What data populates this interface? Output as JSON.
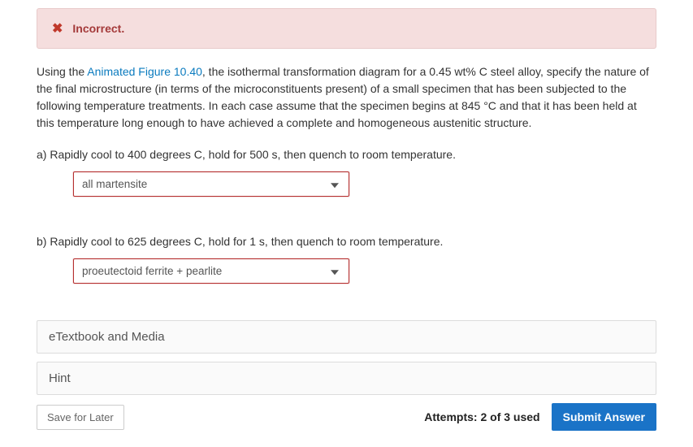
{
  "alert": {
    "icon_name": "x-icon",
    "text": "Incorrect."
  },
  "question": {
    "prefix": "Using the ",
    "link_text": "Animated Figure 10.40",
    "suffix": ", the isothermal transformation diagram for a 0.45 wt% C steel alloy, specify the nature of the final microstructure (in terms of the microconstituents present) of a small specimen that has been subjected to the following temperature treatments. In each case assume that the specimen begins at 845 °C and that it has been held at this temperature long enough to have achieved a complete and homogeneous austenitic structure."
  },
  "parts": {
    "a": {
      "label": "a) Rapidly cool to 400 degrees C, hold for 500 s, then quench to room temperature.",
      "selected": "all martensite"
    },
    "b": {
      "label": "b) Rapidly cool to 625 degrees C, hold for 1 s, then quench to room temperature.",
      "selected": "proeutectoid ferrite + pearlite"
    }
  },
  "accordion": {
    "etextbook": "eTextbook and Media",
    "hint": "Hint"
  },
  "footer": {
    "save": "Save for Later",
    "attempts": "Attempts: 2 of 3 used",
    "submit": "Submit Answer"
  }
}
